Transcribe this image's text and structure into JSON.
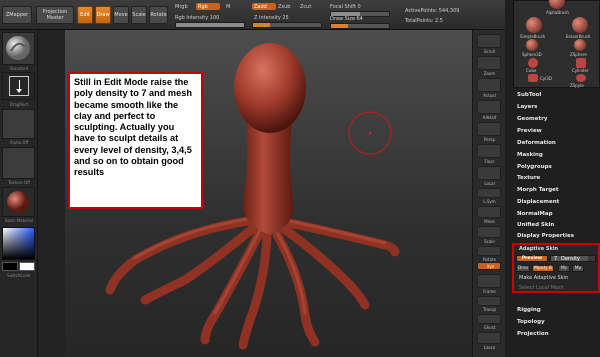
{
  "topbar": {
    "zmapper_label": "ZMapper",
    "projection_label": "Projection",
    "master_label": "Master",
    "edit_label": "Edit",
    "draw_label": "Draw",
    "move_label": "Move",
    "scale_label": "Scale",
    "rotate_label": "Rotate",
    "mrgb_label": "Mrgb",
    "rgb_label": "Rgb",
    "m_label": "M",
    "rgb_intensity_label": "Rgb Intensity 100",
    "zadd_label": "Zadd",
    "zsub_label": "Zsub",
    "zcut_label": "Zcut",
    "z_intensity_label": "Z Intensity 25",
    "focal_shift_label": "Focal Shift 0",
    "draw_size_label": "Draw Size 64",
    "active_points_label": "ActivePoints: 544,309",
    "total_points_label": "TotalPoints: 2.5"
  },
  "leftpanel": {
    "standard_label": "Standard",
    "dragrect_label": "DragRect",
    "alpha_label": "Alpha Off",
    "texture_label": "Texture Off",
    "material_label": "Basic Material",
    "switch_color_label": "SwitchColor"
  },
  "canvas": {
    "note_text": "Still in Edit Mode raise the poly density to 7 and mesh became smooth like the clay and perfect to sculpting. Actually you have to sculpt details at every level of density, 3,4,5 and so on to obtain good results"
  },
  "iconstrip": {
    "scroll": "Scroll",
    "zoom": "Zoom",
    "actual": "Actual",
    "aahalf": "AAHalf",
    "persp": "Persp",
    "floor": "Floor",
    "local": "Local",
    "lsym": "L.Sym",
    "move": "Move",
    "scale": "Scale",
    "rotate": "Rotate",
    "xyz": "Xyz",
    "frame": "Frame",
    "transp": "Transp",
    "ghost": "Ghost",
    "lasso": "Lasso"
  },
  "materials": {
    "alphabrush": "AlphaBrush",
    "simplebrush": "SimpleBrush",
    "eraserbrush": "EraserBrush",
    "sphere3d": "Sphere3D",
    "zsphere": "ZSphere",
    "cube": "Cube",
    "cylinder": "Cylinder",
    "cylinder3d": "Cyl3D",
    "zspyle": "ZSpyle"
  },
  "rightmenu": {
    "subtool": "SubTool",
    "layers": "Layers",
    "geometry": "Geometry",
    "preview": "Preview",
    "deformation": "Deformation",
    "masking": "Masking",
    "polygroups": "Polygroups",
    "texture": "Texture",
    "morph_target": "Morph Target",
    "displacement": "Displacement",
    "normalmap": "NormalMap",
    "unified_skin": "Unified Skin",
    "display_properties": "Display Properties",
    "adaptive_skin": "Adaptive Skin",
    "rigging": "Rigging",
    "topology": "Topology",
    "projection": "Projection"
  },
  "adaptive": {
    "preview_label": "Preview",
    "density_label": "Density",
    "density_value": "7",
    "density_fill": 0.85,
    "dres_label": "Dres",
    "mpoly_label": "Mpoly",
    "mpoly_value": "8",
    "mc_label": "Mc",
    "mp_label": "Mp",
    "make_label": "Make Adaptive Skin",
    "local_mesh_label": "Select Local Mesh"
  },
  "colors": {
    "accent_orange": "#d8822a",
    "highlight_red": "#d00000",
    "model_red": "#a13b2c"
  }
}
